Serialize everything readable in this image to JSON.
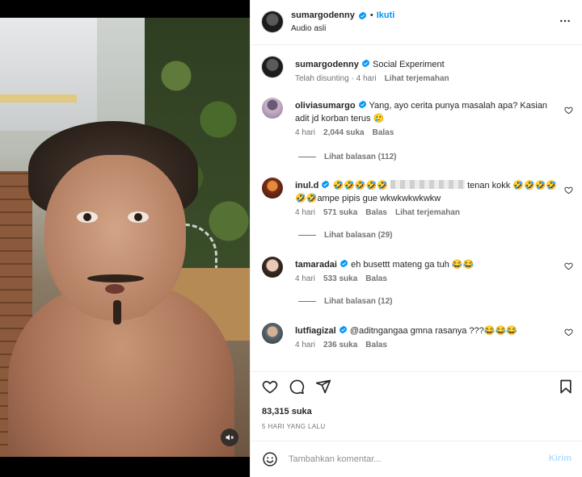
{
  "post": {
    "username": "sumargodenny",
    "follow_label": "Ikuti",
    "separator": "•",
    "subtitle": "Audio asli",
    "caption": {
      "username": "sumargodenny",
      "text": "Social Experiment",
      "edited": "Telah disunting",
      "time": "4 hari",
      "translate": "Lihat terjemahan"
    }
  },
  "comments": [
    {
      "username": "oliviasumargo",
      "text": "Yang, ayo cerita punya masalah apa? Kasian adit jd korban terus 🥲",
      "time": "4 hari",
      "likes": "2,044 suka",
      "reply": "Balas",
      "view_replies": "Lihat balasan (112)"
    },
    {
      "username": "inul.d",
      "text_before": "🤣🤣🤣🤣🤣",
      "text_after": "tenan kokk 🤣🤣🤣🤣🤣🤣ampe pipis gue wkwkwkwkwkw",
      "time": "4 hari",
      "likes": "571 suka",
      "reply": "Balas",
      "translate": "Lihat terjemahan",
      "view_replies": "Lihat balasan (29)"
    },
    {
      "username": "tamaradai",
      "text": "eh busettt mateng ga tuh 😂😂",
      "time": "4 hari",
      "likes": "533 suka",
      "reply": "Balas",
      "view_replies": "Lihat balasan (12)"
    },
    {
      "username": "lutfiagizal",
      "text": "@aditngangaa gmna rasanya ???😂😂😂",
      "time": "4 hari",
      "likes": "236 suka",
      "reply": "Balas"
    }
  ],
  "actions": {
    "likes": "83,315 suka",
    "date": "5 HARI YANG LALU"
  },
  "add_comment": {
    "placeholder": "Tambahkan komentar...",
    "post_label": "Kirim"
  },
  "icons": {
    "verified": "verified-badge-icon",
    "more": "more-options-icon",
    "like": "heart-icon",
    "comment": "comment-bubble-icon",
    "share": "paper-plane-icon",
    "save": "bookmark-icon",
    "emoji": "emoji-smile-icon",
    "mute": "speaker-muted-icon"
  },
  "colors": {
    "accent": "#0095f6",
    "muted_text": "#737373",
    "post_disabled": "#b2dffc",
    "verified": "#0095f6"
  }
}
